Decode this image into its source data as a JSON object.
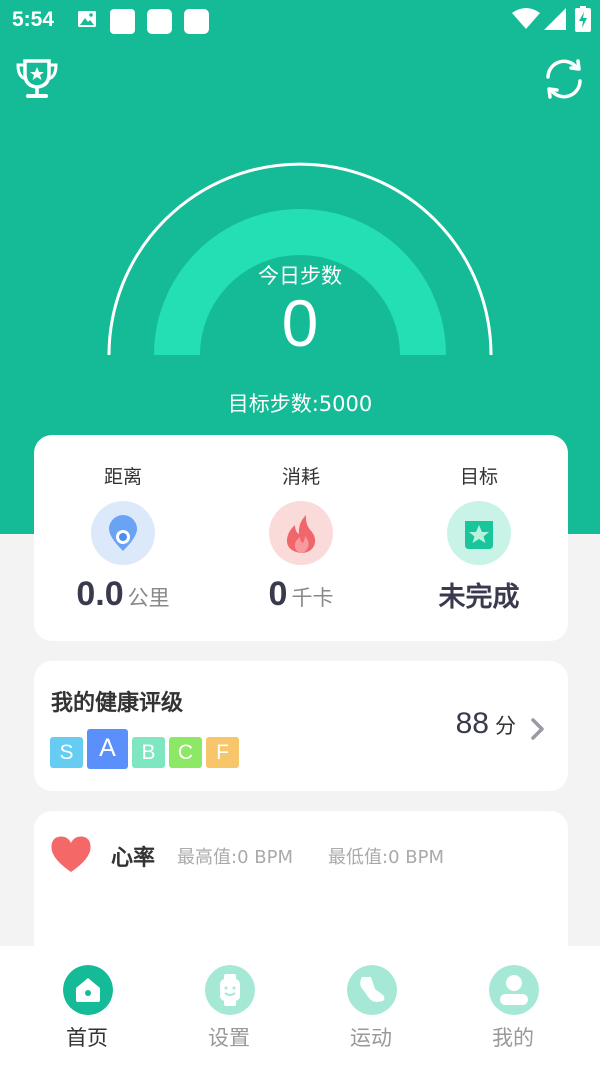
{
  "colors": {
    "brand": "#14bb96",
    "gauge_fill": "#23dfb3",
    "card_bg": "#ffffff",
    "page_bg": "#f3f3f3"
  },
  "status_bar": {
    "time": "5:54",
    "icons": [
      "image-icon",
      "square-icon",
      "square-icon",
      "square-icon",
      "wifi-icon",
      "signal-icon",
      "battery-charging-icon"
    ]
  },
  "header": {
    "left_icon": "trophy-icon",
    "right_icon": "refresh-icon"
  },
  "steps": {
    "label": "今日步数",
    "value": "0",
    "target": "目标步数:5000"
  },
  "stats": [
    {
      "title": "距离",
      "icon": "location-pin-icon",
      "value": "0.0",
      "unit": "公里"
    },
    {
      "title": "消耗",
      "icon": "flame-icon",
      "value": "0",
      "unit": "千卡"
    },
    {
      "title": "目标",
      "icon": "star-badge-icon",
      "value": "未完成"
    }
  ],
  "health": {
    "title": "我的健康评级",
    "grades": [
      {
        "letter": "S",
        "color": "#66ccf2"
      },
      {
        "letter": "A",
        "color": "#5b8ff9"
      },
      {
        "letter": "B",
        "color": "#7ee6c1"
      },
      {
        "letter": "C",
        "color": "#8de866"
      },
      {
        "letter": "F",
        "color": "#f7c66a"
      }
    ],
    "active_grade": "A",
    "score": "88",
    "score_unit": "分"
  },
  "heart_rate": {
    "title": "心率",
    "max": "最高值:0 BPM",
    "min": "最低值:0 BPM"
  },
  "tabs": [
    {
      "label": "首页",
      "icon": "home-icon",
      "active": true
    },
    {
      "label": "设置",
      "icon": "watch-icon",
      "active": false
    },
    {
      "label": "运动",
      "icon": "shoe-icon",
      "active": false
    },
    {
      "label": "我的",
      "icon": "user-icon",
      "active": false
    }
  ]
}
